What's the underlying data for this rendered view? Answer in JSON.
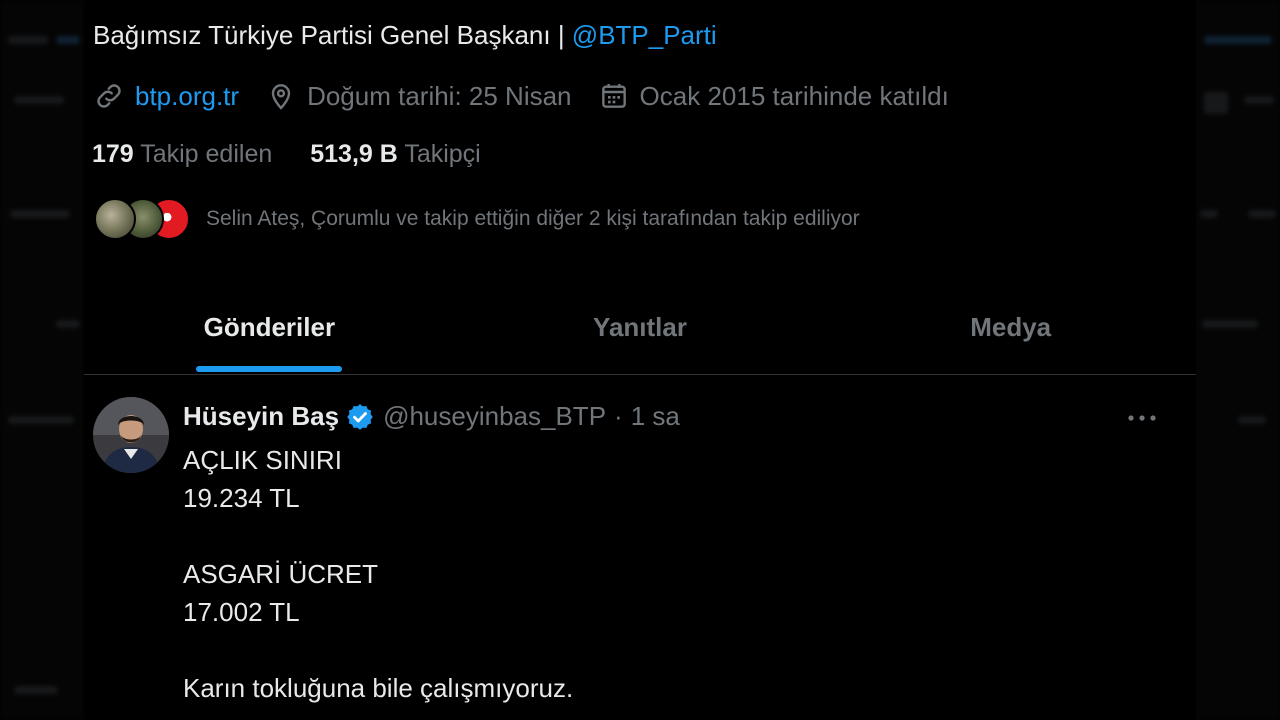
{
  "profile": {
    "bio_text": "Bağımsız Türkiye Partisi Genel Başkanı | ",
    "bio_mention": "@BTP_Parti",
    "website": "btp.org.tr",
    "birthday": "Doğum tarihi: 25 Nisan",
    "joined": "Ocak 2015 tarihinde katıldı",
    "following_count": "179",
    "following_label": "Takip edilen",
    "followers_count": "513,9 B",
    "followers_label": "Takipçi",
    "followed_by": "Selin Ateş, Çorumlu ve takip ettiğin diğer 2 kişi tarafından takip ediliyor"
  },
  "tabs": [
    {
      "label": "Gönderiler",
      "active": true
    },
    {
      "label": "Yanıtlar",
      "active": false
    },
    {
      "label": "Medya",
      "active": false
    }
  ],
  "tweet": {
    "author_name": "Hüseyin Baş",
    "handle": "@huseyinbas_BTP",
    "separator": "·",
    "time": "1 sa",
    "lines": [
      "AÇLIK SINIRI",
      "19.234 TL",
      "",
      "ASGARİ ÜCRET",
      "17.002 TL",
      "",
      "Karın tokluğuna bile çalışmıyoruz."
    ]
  },
  "icons": {
    "link": "link-icon",
    "location": "location-pin-icon",
    "calendar": "calendar-icon",
    "verified": "verified-badge-icon",
    "more": "more-horizontal-icon"
  },
  "colors": {
    "accent": "#1d9bf0",
    "muted": "#71767b",
    "text": "#e7e9ea",
    "background": "#000000"
  }
}
